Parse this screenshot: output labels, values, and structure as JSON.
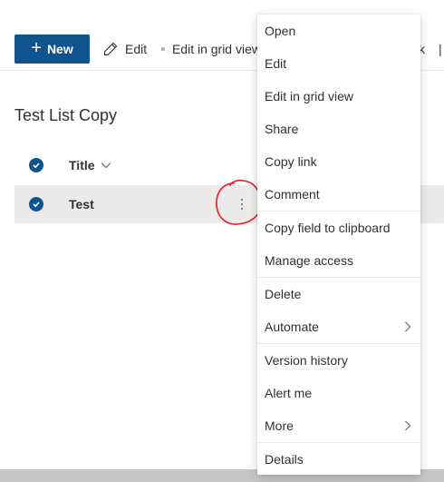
{
  "toolbar": {
    "new_label": "New",
    "edit_label": "Edit",
    "grid_label": "Edit in grid view",
    "partial_label": "k",
    "partial2_label": "|"
  },
  "list": {
    "title": "Test List Copy",
    "column_title": "Title",
    "rows": [
      {
        "title": "Test"
      }
    ]
  },
  "menu": {
    "items": [
      {
        "label": "Open"
      },
      {
        "label": "Edit"
      },
      {
        "label": "Edit in grid view"
      },
      {
        "label": "Share"
      },
      {
        "label": "Copy link"
      },
      {
        "label": "Comment"
      },
      {
        "label": "Copy field to clipboard"
      },
      {
        "label": "Manage access"
      },
      {
        "label": "Delete"
      },
      {
        "label": "Automate",
        "submenu": true
      },
      {
        "label": "Version history"
      },
      {
        "label": "Alert me"
      },
      {
        "label": "More",
        "submenu": true
      },
      {
        "label": "Details"
      }
    ]
  },
  "colors": {
    "accent": "#0f548c",
    "selected_row": "#edebe9",
    "annotation": "#e02020"
  },
  "icons": [
    "plus-icon",
    "pencil-icon",
    "grid-icon",
    "check-circle-icon",
    "chevron-down-icon",
    "more-vertical-icon",
    "chevron-right-icon"
  ]
}
